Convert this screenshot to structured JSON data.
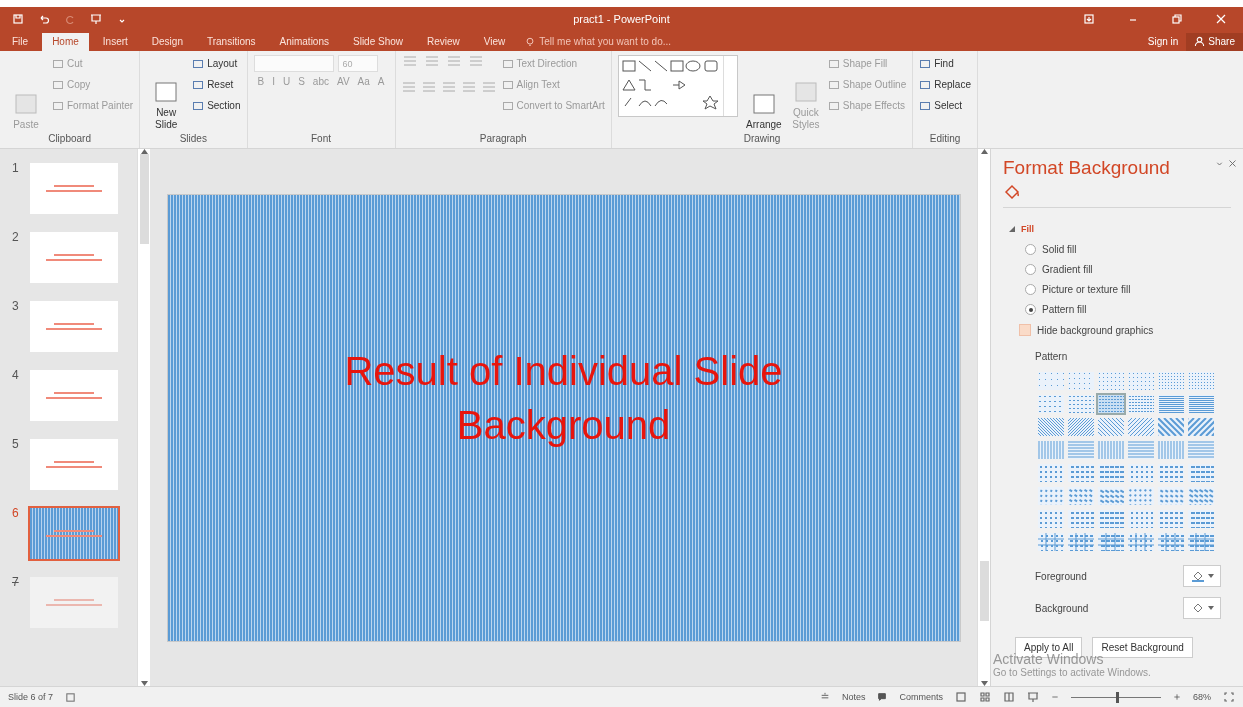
{
  "window": {
    "title": "pract1 - PowerPoint"
  },
  "tabs": [
    {
      "label": "File",
      "selected": false
    },
    {
      "label": "Home",
      "selected": true
    },
    {
      "label": "Insert",
      "selected": false
    },
    {
      "label": "Design",
      "selected": false
    },
    {
      "label": "Transitions",
      "selected": false
    },
    {
      "label": "Animations",
      "selected": false
    },
    {
      "label": "Slide Show",
      "selected": false
    },
    {
      "label": "Review",
      "selected": false
    },
    {
      "label": "View",
      "selected": false
    }
  ],
  "tell_me": {
    "placeholder": "Tell me what you want to do..."
  },
  "sign_in": "Sign in",
  "share": "Share",
  "ribbon": [
    {
      "kind": "clipboard",
      "label": "Clipboard",
      "big": [
        {
          "label": "Paste",
          "disabled": true
        }
      ],
      "items": [
        {
          "label": "Cut",
          "disabled": true
        },
        {
          "label": "Copy",
          "disabled": true
        },
        {
          "label": "Format Painter",
          "disabled": true
        }
      ]
    },
    {
      "kind": "slides",
      "label": "Slides",
      "big": [
        {
          "label": "New Slide",
          "disabled": false
        }
      ],
      "items": [
        {
          "label": "Layout",
          "disabled": false
        },
        {
          "label": "Reset",
          "disabled": false
        },
        {
          "label": "Section",
          "disabled": false
        }
      ]
    },
    {
      "kind": "font",
      "label": "Font",
      "size": "60",
      "buttons": [
        "B",
        "I",
        "U",
        "S",
        "abc",
        "AV",
        "Aa",
        "A"
      ]
    },
    {
      "kind": "paragraph",
      "label": "Paragraph",
      "items": [
        {
          "label": "Text Direction",
          "disabled": true
        },
        {
          "label": "Align Text",
          "disabled": true
        },
        {
          "label": "Convert to SmartArt",
          "disabled": true
        }
      ]
    },
    {
      "kind": "drawing",
      "label": "Drawing",
      "big": [
        {
          "label": "Arrange",
          "disabled": false
        },
        {
          "label": "Quick Styles",
          "disabled": true
        }
      ],
      "items": [
        {
          "label": "Shape Fill",
          "disabled": true
        },
        {
          "label": "Shape Outline",
          "disabled": true
        },
        {
          "label": "Shape Effects",
          "disabled": true
        }
      ]
    },
    {
      "kind": "editing",
      "label": "Editing",
      "items": [
        {
          "label": "Find",
          "disabled": false
        },
        {
          "label": "Replace",
          "disabled": false
        },
        {
          "label": "Select",
          "disabled": false
        }
      ]
    }
  ],
  "slides": [
    {
      "number": "1",
      "selected": false,
      "hidden": false,
      "kind": "plain"
    },
    {
      "number": "2",
      "selected": false,
      "hidden": false,
      "kind": "plain"
    },
    {
      "number": "3",
      "selected": false,
      "hidden": false,
      "kind": "plain"
    },
    {
      "number": "4",
      "selected": false,
      "hidden": false,
      "kind": "plain"
    },
    {
      "number": "5",
      "selected": false,
      "hidden": false,
      "kind": "plain"
    },
    {
      "number": "6",
      "selected": true,
      "hidden": false,
      "kind": "pattern"
    },
    {
      "number": "7",
      "selected": false,
      "hidden": true,
      "kind": "plain"
    }
  ],
  "slide": {
    "title": "Result of Individual Slide Background"
  },
  "pane": {
    "title": "Format Background",
    "section": {
      "label": "Fill",
      "expanded": true
    },
    "options": [
      {
        "label": "Solid fill",
        "selected": false
      },
      {
        "label": "Gradient fill",
        "selected": false
      },
      {
        "label": "Picture or texture fill",
        "selected": false
      },
      {
        "label": "Pattern fill",
        "selected": true
      }
    ],
    "hide_graphics": {
      "label": "Hide background graphics",
      "checked": false
    },
    "pattern_label": "Pattern",
    "patterns": [
      {
        "selected": false
      },
      {
        "selected": false
      },
      {
        "selected": false
      },
      {
        "selected": false
      },
      {
        "selected": false
      },
      {
        "selected": false
      },
      {
        "selected": false
      },
      {
        "selected": false
      },
      {
        "selected": true
      },
      {
        "selected": false
      },
      {
        "selected": false
      },
      {
        "selected": false
      },
      {
        "selected": false
      },
      {
        "selected": false
      },
      {
        "selected": false
      },
      {
        "selected": false
      },
      {
        "selected": false
      },
      {
        "selected": false
      },
      {
        "selected": false
      },
      {
        "selected": false
      },
      {
        "selected": false
      },
      {
        "selected": false
      },
      {
        "selected": false
      },
      {
        "selected": false
      },
      {
        "selected": false
      },
      {
        "selected": false
      },
      {
        "selected": false
      },
      {
        "selected": false
      },
      {
        "selected": false
      },
      {
        "selected": false
      },
      {
        "selected": false
      },
      {
        "selected": false
      },
      {
        "selected": false
      },
      {
        "selected": false
      },
      {
        "selected": false
      },
      {
        "selected": false
      },
      {
        "selected": false
      },
      {
        "selected": false
      },
      {
        "selected": false
      },
      {
        "selected": false
      },
      {
        "selected": false
      },
      {
        "selected": false
      },
      {
        "selected": false
      },
      {
        "selected": false
      },
      {
        "selected": false
      },
      {
        "selected": false
      },
      {
        "selected": false
      },
      {
        "selected": false
      }
    ],
    "colors": [
      {
        "label": "Foreground"
      },
      {
        "label": "Background"
      }
    ],
    "buttons": [
      "Apply to All",
      "Reset Background"
    ],
    "notice": [
      "Activate Windows",
      "Go to Settings to activate Windows."
    ]
  },
  "status": {
    "slide": "Slide 6 of 7",
    "notes": "Notes",
    "comments": "Comments",
    "zoom": "68%",
    "level": 0.5
  }
}
